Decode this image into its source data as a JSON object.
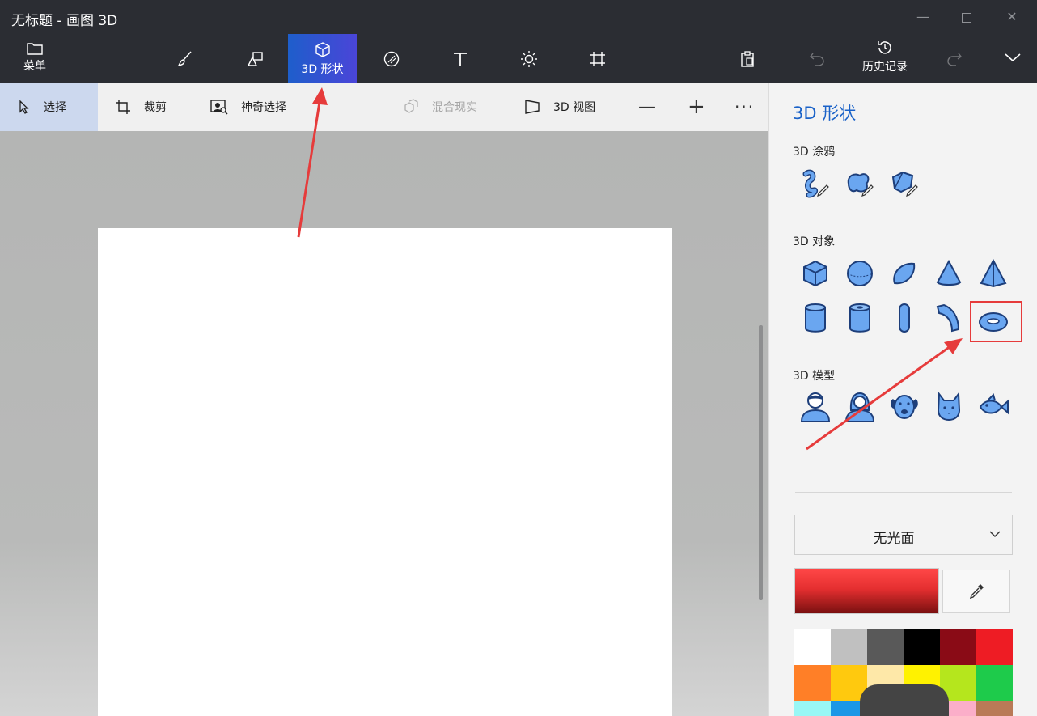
{
  "window": {
    "title": "无标题 - 画图 3D",
    "minimize_glyph": "—",
    "close_glyph": "✕"
  },
  "ribbon": {
    "menu_label": "菜单",
    "shapes3d_label": "3D 形状",
    "history_label": "历史记录",
    "icons": [
      "folder-icon",
      "brush-icon",
      "2d-shapes-icon",
      "cube-icon",
      "sticker-icon",
      "text-icon",
      "effects-icon",
      "canvas-icon",
      "paste-icon",
      "undo-icon",
      "history-icon",
      "redo-icon",
      "chevron-down-icon"
    ]
  },
  "toolbar": {
    "select_label": "选择",
    "crop_label": "裁剪",
    "magic_select_label": "神奇选择",
    "mixed_reality_label": "混合现实",
    "view3d_label": "3D 视图",
    "zoom_out_glyph": "—",
    "zoom_in_glyph": "+",
    "more_glyph": "···"
  },
  "panel": {
    "title": "3D 形状",
    "doodle_section": "3D 涂鸦",
    "objects_section": "3D 对象",
    "models_section": "3D 模型",
    "doodles": [
      "sharp-edge-doodle-icon",
      "soft-edge-doodle-icon",
      "tube-doodle-icon"
    ],
    "objects": [
      "cube-icon",
      "sphere-icon",
      "hemisphere-icon",
      "cone-icon",
      "pyramid-icon",
      "cylinder-icon",
      "tube-icon",
      "capsule-icon",
      "curved-tube-icon",
      "donut-icon"
    ],
    "models": [
      "man-icon",
      "woman-icon",
      "dog-icon",
      "cat-icon",
      "fish-icon"
    ],
    "selected_object": "donut-icon",
    "finish_value": "无光面",
    "current_color": "#e52f30",
    "palette": [
      "#ffffff",
      "#c0c0c0",
      "#595959",
      "#000000",
      "#8a0b16",
      "#ee1c24",
      "#ff7f27",
      "#ffc90e",
      "#fee8a8",
      "#fff200",
      "#b5e61d",
      "#1ecb4b",
      "#99f7f5",
      "#1b97e6",
      "#fdf2b7",
      "#f4f500",
      "#fbaec9",
      "#b97a57"
    ]
  },
  "accent": "#1a62c8",
  "annotation_color": "#e63b3b"
}
